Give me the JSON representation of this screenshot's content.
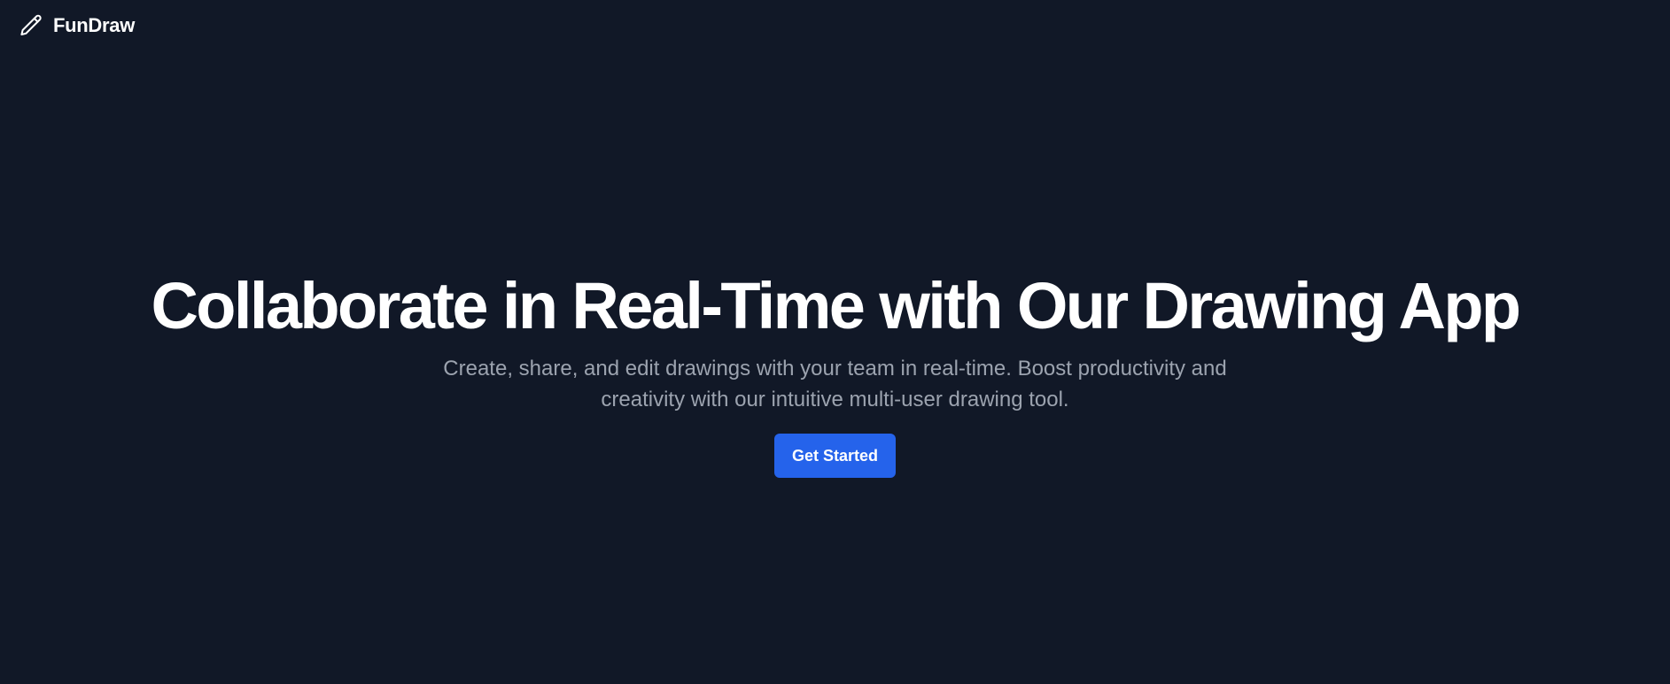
{
  "header": {
    "logo_icon": "pencil-icon",
    "brand_name": "FunDraw"
  },
  "hero": {
    "headline": "Collaborate in Real-Time with Our Drawing App",
    "subtitle": "Create, share, and edit drawings with your team in real-time. Boost productivity and creativity with our intuitive multi-user drawing tool.",
    "cta_label": "Get Started"
  },
  "colors": {
    "background": "#111827",
    "headline": "#ffffff",
    "subtitle": "#9ca3af",
    "button": "#2563eb"
  }
}
